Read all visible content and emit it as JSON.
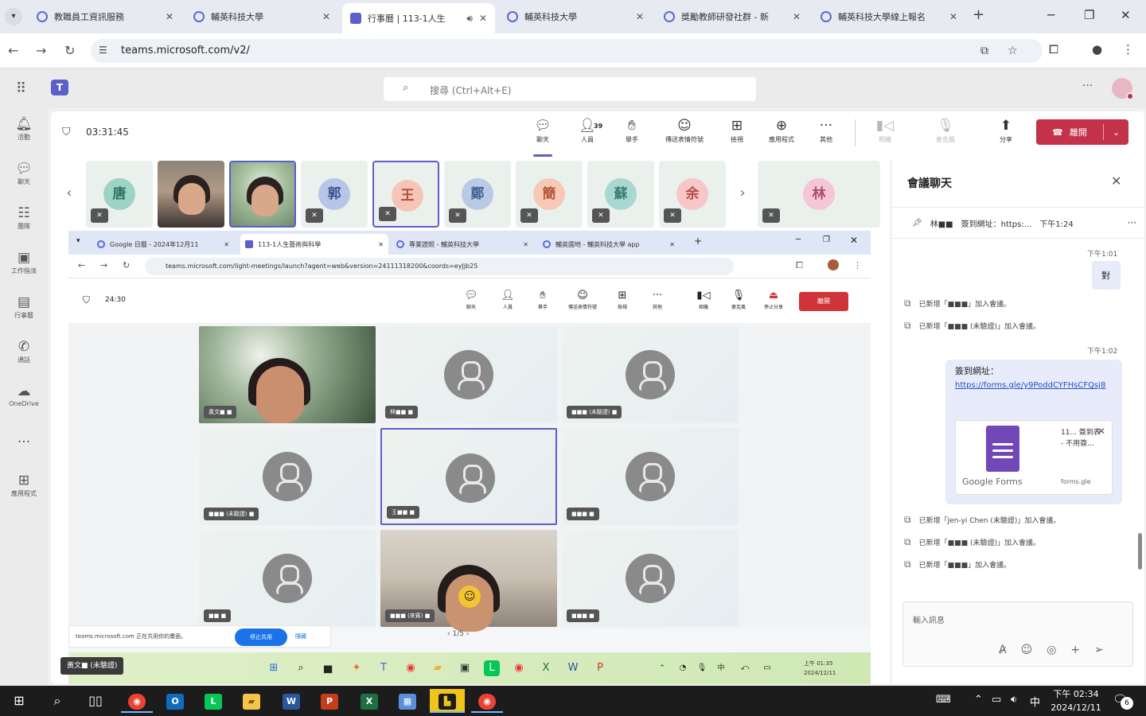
{
  "browser": {
    "tabs": [
      {
        "label": "教職員工資訊服務",
        "active": false,
        "icon": "globe-icon"
      },
      {
        "label": "輔英科技大學",
        "active": false,
        "icon": "globe-icon"
      },
      {
        "label": "行事曆 | 113-1人生",
        "active": true,
        "icon": "teams-icon"
      },
      {
        "label": "輔英科技大學",
        "active": false,
        "icon": "globe-icon"
      },
      {
        "label": "獎勵教師研發社群 - 新",
        "active": false,
        "icon": "globe-icon"
      },
      {
        "label": "輔英科技大學線上報名",
        "active": false,
        "icon": "globe-icon"
      }
    ],
    "url": "teams.microsoft.com/v2/"
  },
  "teams_header": {
    "search_placeholder": "搜尋 (Ctrl+Alt+E)"
  },
  "rail": [
    {
      "label": "活動",
      "icon": "bell-icon"
    },
    {
      "label": "聊天",
      "icon": "chat-icon"
    },
    {
      "label": "團隊",
      "icon": "teams-group-icon"
    },
    {
      "label": "工作指派",
      "icon": "assignment-icon"
    },
    {
      "label": "行事曆",
      "icon": "calendar-icon"
    },
    {
      "label": "通話",
      "icon": "phone-icon"
    },
    {
      "label": "OneDrive",
      "icon": "cloud-icon"
    },
    {
      "label": "應用程式",
      "icon": "apps-add-icon"
    }
  ],
  "meeting": {
    "timer": "03:31:45",
    "toolbar": {
      "chat": "聊天",
      "people": "人員",
      "people_count": "39",
      "raise": "舉手",
      "react": "傳送表情符號",
      "view": "檢視",
      "apps": "應用程式",
      "more": "其他",
      "camera": "相機",
      "mic": "麥克風",
      "share": "分享",
      "leave": "離開"
    },
    "strip": [
      {
        "initial": "唐",
        "color": "#9bd3c4",
        "text": "#2f6f62",
        "type": "avatar"
      },
      {
        "initial": "",
        "type": "photo1"
      },
      {
        "initial": "",
        "type": "photo2",
        "selected": true
      },
      {
        "initial": "郭",
        "color": "#b7c6e8",
        "text": "#3d4f8c",
        "type": "avatar"
      },
      {
        "initial": "王",
        "color": "#f6c5b8",
        "text": "#b0513a",
        "type": "avatar",
        "selected": true
      },
      {
        "initial": "鄭",
        "color": "#b9cbe4",
        "text": "#44618f",
        "type": "avatar"
      },
      {
        "initial": "簡",
        "color": "#f8c8b6",
        "text": "#b2573b",
        "type": "avatar"
      },
      {
        "initial": "蘇",
        "color": "#a9d8d2",
        "text": "#3e7d75",
        "type": "avatar"
      },
      {
        "initial": "余",
        "color": "#f7c7c7",
        "text": "#b24b4b",
        "type": "avatar"
      },
      {
        "initial": "林",
        "color": "#f4c6d6",
        "text": "#b0486f",
        "type": "avatar"
      }
    ]
  },
  "share_screen": {
    "tabs": [
      {
        "label": "Google 日曆 - 2024年12月11",
        "active": false
      },
      {
        "label": "113-1人生藝術與科學",
        "active": true
      },
      {
        "label": "專業證照 - 輔英科技大學",
        "active": false
      },
      {
        "label": "輔英園地 - 輔英科技大學 app",
        "active": false
      }
    ],
    "url": "teams.microsoft.com/light-meetings/launch?agent=web&version=24111318200&coords=eyJjb25",
    "timer": "24:30",
    "toolbar": [
      "聊天",
      "人員",
      "舉手",
      "傳送表情符號",
      "檢視",
      "其他",
      "相機",
      "麥克風",
      "停止分享"
    ],
    "leave": "離開",
    "tiles": [
      {
        "name": "黃文■ ■",
        "type": "photo1",
        "selected": false
      },
      {
        "name": "林■■ ■",
        "type": "avatar",
        "selected": false
      },
      {
        "name": "■■■ (未驗證) ■",
        "type": "avatar",
        "selected": false
      },
      {
        "name": "■■■ (未驗證) ■",
        "type": "avatar",
        "selected": false
      },
      {
        "name": "王■■ ■",
        "type": "avatar",
        "selected": true
      },
      {
        "name": "■■■ ■",
        "type": "avatar",
        "selected": false
      },
      {
        "name": "■■ ■",
        "type": "avatar",
        "selected": false
      },
      {
        "name": "■■■ (來賓) ■",
        "type": "photo2",
        "selected": false
      },
      {
        "name": "■■■ ■",
        "type": "avatar",
        "selected": false
      }
    ],
    "page": "1/5",
    "notice": "teams.microsoft.com 正在共用你的畫面。",
    "notice_share": "停止共用",
    "notice_hide": "隱藏",
    "clock_time": "上午 01:35",
    "clock_date": "2024/12/11",
    "self_name": "黃文■ (未驗證)"
  },
  "chat": {
    "title": "會議聊天",
    "pinned_author": "林■■",
    "pinned_text": "簽到網址：https:...",
    "pinned_time": "下午1:24",
    "time1": "下午1:01",
    "my_msg1": "對",
    "sys1": "已新增「■■■」加入會議。",
    "sys2": "已新增「■■■ (未驗證)」加入會議。",
    "time2": "下午1:02",
    "link_label": "簽到網址：",
    "link_url": "https://forms.gle/y9PoddCYFHsCFQsj8",
    "forms_title": "11... 簽到表 - 不用簽...",
    "forms_brand": "Google Forms",
    "forms_domain": "forms.gle",
    "sys3": "已新增「Jen-yi Chen (未驗證)」加入會議。",
    "sys4": "已新增「■■■ (未驗證)」加入會議。",
    "sys5": "已新增「■■■」加入會議。",
    "compose_placeholder": "輸入訊息"
  },
  "taskbar": {
    "ime": "中",
    "time": "下午 02:34",
    "date": "2024/12/11",
    "notif_count": "6"
  }
}
